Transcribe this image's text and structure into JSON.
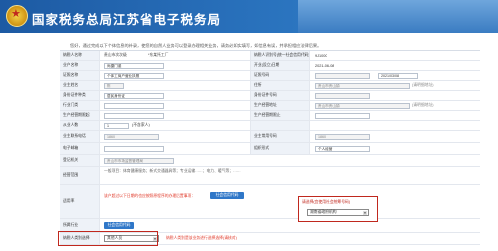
{
  "header": {
    "title": "国家税务总局江苏省电子税务局"
  },
  "intro": "您好，通过完成以下个体信息的补录，使您的自然人业务可以登录办理相关业务，请务必如实填写，如信息有误，并承担相应法律后果。",
  "rows": [
    {
      "label": "纳税人名称",
      "value": "贵山市次次级",
      "mid_value": "*东某托工厂",
      "right_label": "纳税人识别号(统一社会信用代码)",
      "right_value": "9J1000"
    },
    {
      "label": "业户名称",
      "value": "尚捷门诞",
      "right_label": "开业(设立)日期",
      "right_value": "2021-06-08"
    },
    {
      "label": "证照名称",
      "value": "个体工商户营业执照",
      "right_label": "证照号码",
      "right_value": "",
      "right_date": "2021/03/08"
    },
    {
      "label": "业主姓名",
      "value": "陈",
      "right_label": "住所",
      "right_value": "贵山市贵山镇",
      "right_hint": "(请明细地址)"
    },
    {
      "label": "身份证件种类",
      "value": "居民身份证",
      "right_label": "身份证件号码",
      "right_value": ""
    },
    {
      "label": "行业门类",
      "value": "",
      "right_label": "生产经营地址",
      "right_value": "贵山市贵山镇",
      "right_hint": "(请明细地址)"
    },
    {
      "label": "生产经营期限起",
      "value": "",
      "right_label": "生产经营期限止",
      "right_value": ""
    },
    {
      "label": "从业人数",
      "value": "1",
      "unit": "(不含家人)",
      "right_label": "",
      "right_value": ""
    },
    {
      "label": "业主联系电话",
      "value": "1860",
      "right_label": "业主常用号码",
      "right_value": "1860"
    },
    {
      "label": "电子邮箱",
      "value": "",
      "right_label": "组织形式",
      "right_value": "个人经营"
    },
    {
      "label": "登记机关",
      "value": "贵山市市场监督管理局",
      "right_label": "",
      "right_value": ""
    },
    {
      "label": "经营范围",
      "value": "一般项目：体育健康服务；新式交通器具等；专业运输……；电力、暖气等；……"
    },
    {
      "label": "适用率",
      "value": "该户超过以下日期的也应按照原程序的办理后置事项：",
      "btn": "社会信用代码",
      "popup_title": "请选择(宜使用社会统筹号码)",
      "popup_select": "湖南省政府机构"
    },
    {
      "label": "所属行业",
      "value": "",
      "btn": "社会信用代码"
    },
    {
      "label": "纳税人类别选择",
      "value": "其他人员",
      "note": "纳税人类别是该业务进行选择选择(请核对)"
    }
  ]
}
